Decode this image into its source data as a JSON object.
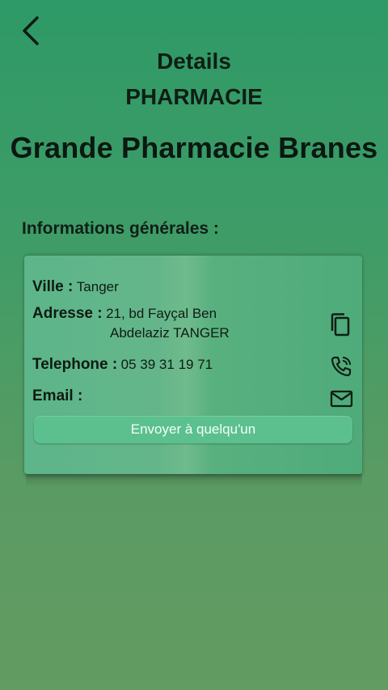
{
  "header": {
    "back_icon": "chevron-left-icon",
    "title_line1": "Details",
    "title_line2": "PHARMACIE"
  },
  "pharmacy": {
    "name": "Grande Pharmacie Branes"
  },
  "section": {
    "title": "Informations générales :"
  },
  "details": {
    "ville_label": "Ville :",
    "ville_value": "Tanger",
    "adresse_label": "Adresse :",
    "adresse_line1": "21, bd Fayçal Ben",
    "adresse_line2": "Abdelaziz TANGER",
    "telephone_label": "Telephone :",
    "telephone_value": "05 39 31 19 71",
    "email_label": "Email :",
    "email_value": ""
  },
  "actions": {
    "copy_icon": "copy-icon",
    "call_icon": "phone-call-icon",
    "mail_icon": "mail-icon",
    "send_label": "Envoyer à quelqu'un"
  },
  "colors": {
    "background_top": "#2e9a67",
    "background_bottom": "#639b62",
    "card": "#5db58a",
    "button": "#5cc08e"
  }
}
